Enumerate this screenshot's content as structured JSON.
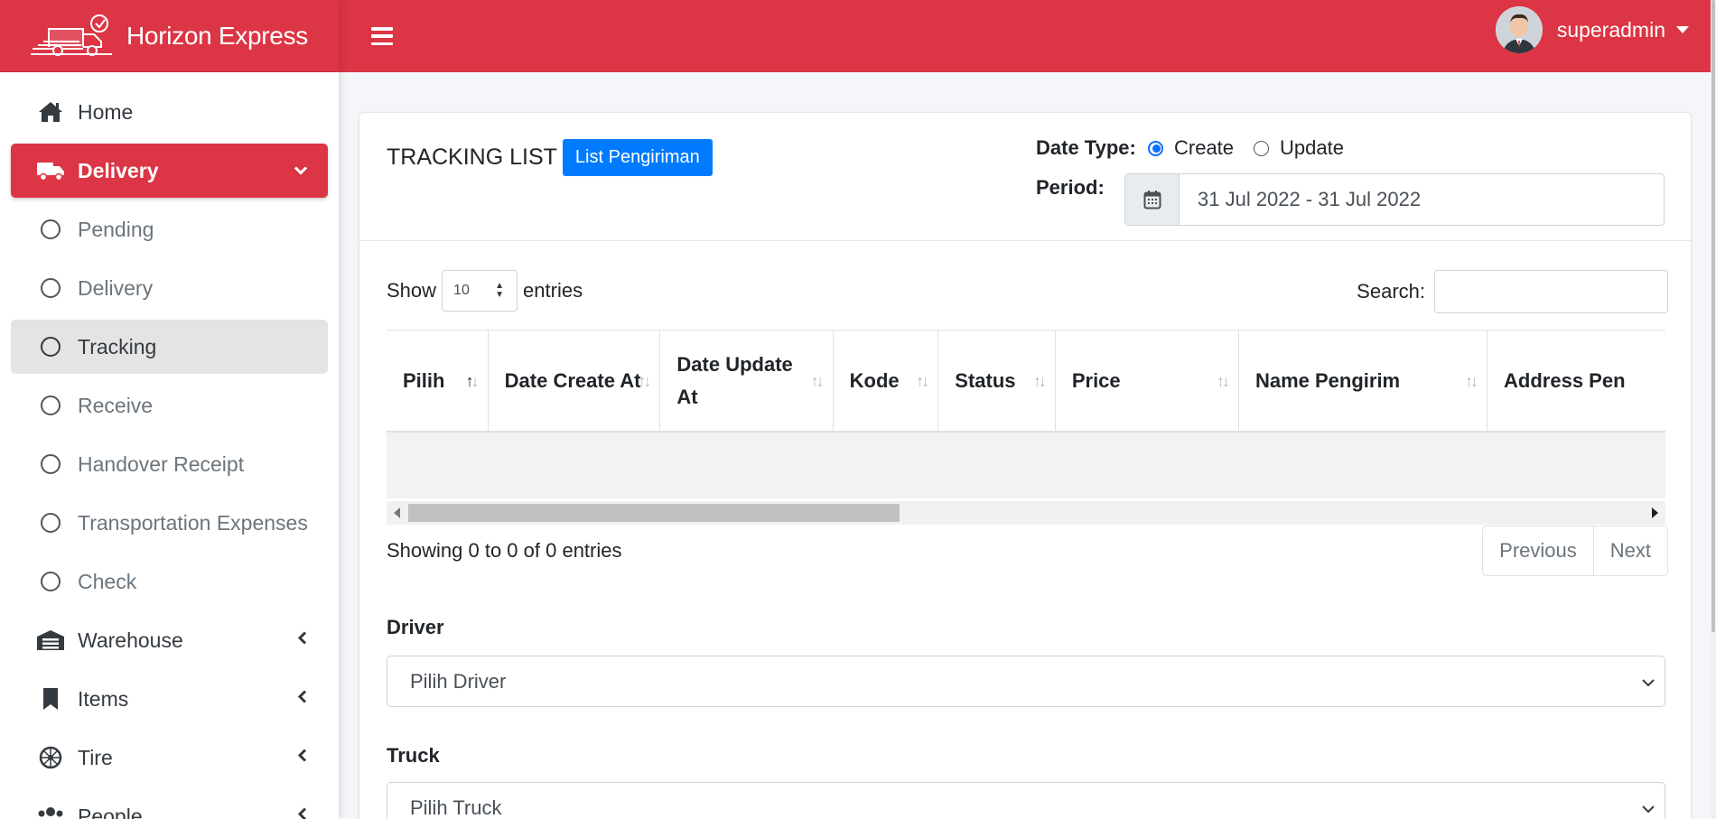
{
  "brand": {
    "name_bold": "Horizon",
    "name_light": "Express"
  },
  "user": {
    "name": "superadmin"
  },
  "sidebar": {
    "items": [
      {
        "label": "Home",
        "icon": "home-icon"
      },
      {
        "label": "Delivery",
        "icon": "truck-icon",
        "active": true
      },
      {
        "label": "Pending",
        "sub": true
      },
      {
        "label": "Delivery",
        "sub": true
      },
      {
        "label": "Tracking",
        "sub": true,
        "selected": true
      },
      {
        "label": "Receive",
        "sub": true
      },
      {
        "label": "Handover Receipt",
        "sub": true
      },
      {
        "label": "Transportation Expenses",
        "sub": true
      },
      {
        "label": "Check",
        "sub": true
      },
      {
        "label": "Warehouse",
        "icon": "warehouse-icon"
      },
      {
        "label": "Items",
        "icon": "bookmark-icon"
      },
      {
        "label": "Tire",
        "icon": "tire-icon"
      },
      {
        "label": "People",
        "icon": "users-icon"
      }
    ]
  },
  "card": {
    "title": "TRACKING LIST",
    "list_button": "List Pengiriman",
    "date_type_label": "Date Type:",
    "date_type_options": [
      "Create",
      "Update"
    ],
    "date_type_selected": "Create",
    "period_label": "Period:",
    "period_value": "31 Jul 2022 - 31 Jul 2022"
  },
  "table": {
    "show_label": "Show",
    "entries_value": "10",
    "entries_label": "entries",
    "search_label": "Search:",
    "columns": [
      {
        "label": "Pilih",
        "sorted": "asc"
      },
      {
        "label": "Date Create At"
      },
      {
        "label": "Date Update At"
      },
      {
        "label": "Kode"
      },
      {
        "label": "Status"
      },
      {
        "label": "Price"
      },
      {
        "label": "Name Pengirim"
      },
      {
        "label": "Address Pen"
      }
    ],
    "info": "Showing 0 to 0 of 0 entries",
    "prev_label": "Previous",
    "next_label": "Next"
  },
  "form": {
    "driver_label": "Driver",
    "driver_placeholder": "Pilih Driver",
    "truck_label": "Truck",
    "truck_placeholder": "Pilih Truck"
  },
  "colors": {
    "brand": "#dc3545",
    "primary": "#007bff"
  }
}
